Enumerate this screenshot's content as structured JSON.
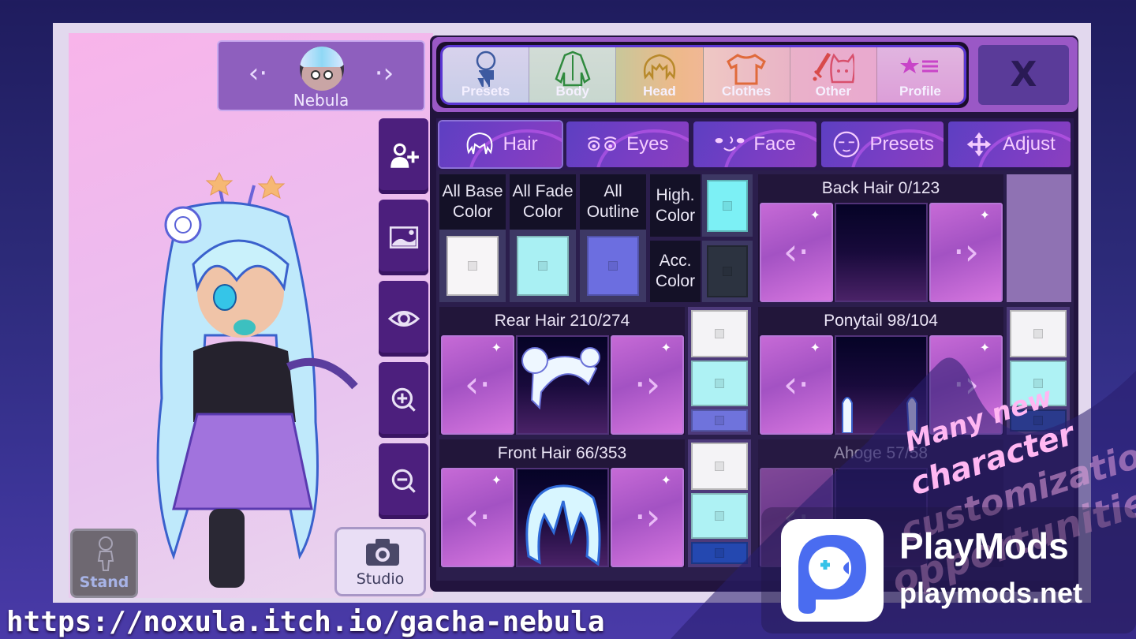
{
  "character_selector": {
    "name": "Nebula",
    "prev_icon": "chevron-left-dot",
    "next_icon": "chevron-right-dot"
  },
  "side_tools": [
    {
      "id": "add-character",
      "icon": "add-person-icon"
    },
    {
      "id": "background",
      "icon": "image-icon"
    },
    {
      "id": "visibility",
      "icon": "eye-icon"
    },
    {
      "id": "zoom-in",
      "icon": "zoom-in-icon"
    },
    {
      "id": "zoom-out",
      "icon": "zoom-out-icon"
    }
  ],
  "bottom_buttons": {
    "stand": "Stand",
    "studio": "Studio"
  },
  "main_tabs": [
    {
      "label": "Presets",
      "icon": "chibi-body-icon",
      "color": "#3d5aa0"
    },
    {
      "label": "Body",
      "icon": "jacket-icon",
      "color": "#2f8a3e"
    },
    {
      "label": "Head",
      "icon": "hair-icon",
      "color": "#b8892a"
    },
    {
      "label": "Clothes",
      "icon": "tshirt-icon",
      "color": "#e06a3b"
    },
    {
      "label": "Other",
      "icon": "sword-cat-icon",
      "color": "#d84a6c"
    },
    {
      "label": "Profile",
      "icon": "star-list-icon",
      "color": "#c844c8"
    }
  ],
  "close_label": "X",
  "sub_tabs": [
    {
      "label": "Hair",
      "icon": "hair-outline-icon",
      "active": true
    },
    {
      "label": "Eyes",
      "icon": "eyes-icon",
      "active": false
    },
    {
      "label": "Face",
      "icon": "face-icon",
      "active": false
    },
    {
      "label": "Presets",
      "icon": "face-preset-icon",
      "active": false
    },
    {
      "label": "Adjust",
      "icon": "move-arrows-icon",
      "active": false
    }
  ],
  "global_colors": [
    {
      "label": "All Base Color",
      "color": "#f7f5f7"
    },
    {
      "label": "All Fade Color",
      "color": "#a9f0f3"
    },
    {
      "label": "All Outline",
      "color": "#6c6ee0"
    },
    {
      "label": "High. Color",
      "color": "#7cf0f5"
    },
    {
      "label": "Acc. Color",
      "color": "#2c3340"
    }
  ],
  "hair_parts": [
    {
      "title": "Back Hair 0/123",
      "colors": [
        "#8f72b3"
      ]
    },
    {
      "title": "Rear Hair 210/274",
      "colors": [
        "#f4f3f6",
        "#aef2f4",
        "#6f73dc"
      ]
    },
    {
      "title": "Ponytail 98/104",
      "colors": [
        "#f4f3f6",
        "#aef2f4",
        "#2a3a8c"
      ]
    },
    {
      "title": "Front Hair 66/353",
      "colors": [
        "#f4f3f6",
        "#aef2f4",
        "#2448b0"
      ]
    },
    {
      "title": "Ahoge 57/58",
      "colors": []
    }
  ],
  "watermark_url": "https://noxula.itch.io/gacha-nebula",
  "promo_lines": [
    "Many new",
    "character",
    "customization",
    "opportunities!"
  ],
  "playmods": {
    "title": "PlayMods",
    "url": "playmods.net"
  }
}
